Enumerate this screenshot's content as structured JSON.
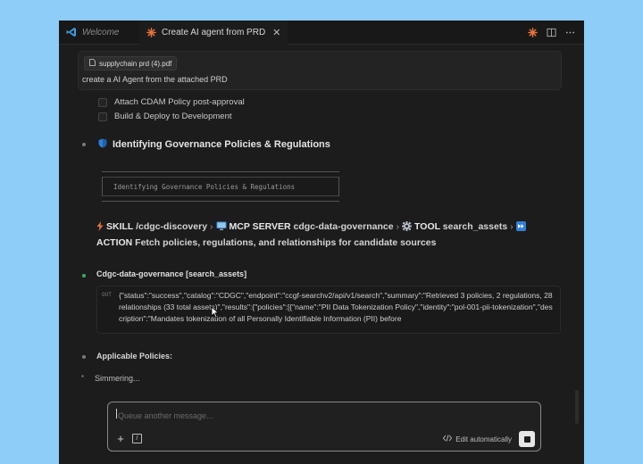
{
  "tabs": {
    "welcome_label": "Welcome",
    "active_label": "Create AI agent from PRD",
    "close_glyph": "✕"
  },
  "prompt": {
    "attachment_name": "supplychain prd (4).pdf",
    "text": "create a AI Agent from the attached PRD"
  },
  "checklist": [
    {
      "label": "Attach CDAM Policy post-approval",
      "checked": false
    },
    {
      "label": "Build & Deploy to Development",
      "checked": false
    }
  ],
  "governance_section": {
    "title": "Identifying Governance Policies & Regulations",
    "code_text": "Identifying Governance Policies & Regulations"
  },
  "trace": {
    "skill_kw": "SKILL",
    "skill_val": "/cdgc-discovery",
    "mcp_kw": "MCP SERVER",
    "mcp_val": "cdgc-data-governance",
    "tool_kw": "TOOL",
    "tool_val": "search_assets",
    "action_kw": "ACTION",
    "action_val": "Fetch policies, regulations, and relationships for candidate sources",
    "separator": "›"
  },
  "tool_call": {
    "title": "Cdgc-data-governance [search_assets]",
    "out_label": "OUT",
    "output": "{\"status\":\"success\",\"catalog\":\"CDGC\",\"endpoint\":\"ccgf-searchv2/api/v1/search\",\"summary\":\"Retrieved 3 policies, 2 regulations, 28 relationships (33 total assets)\",\"results\":{\"policies\":[{\"name\":\"PII Data Tokenization Policy\",\"identity\":\"pol-001-pii-tokenization\",\"description\":\"Mandates tokenization of all Personally Identifiable Information (PII) before"
  },
  "applicable_policies": "Applicable Policies:",
  "status_text": "Simmering...",
  "composer": {
    "placeholder": "Queue another message...",
    "mode_label": "Edit automatically",
    "add_glyph": "+",
    "slash_glyph": "/"
  },
  "icons": {
    "vscode": "vscode-logo-icon",
    "claude": "claude-spark-icon",
    "shield": "shield-icon",
    "skill": "lightning-icon",
    "mcp": "monitor-icon",
    "tool": "gear-icon",
    "action": "fast-forward-icon",
    "stop": "stop-icon"
  },
  "colors": {
    "background": "#8ecdf7",
    "editor": "#1c1c1c",
    "accent_orange": "#e8743b",
    "bullet_green": "#3ea86b"
  }
}
